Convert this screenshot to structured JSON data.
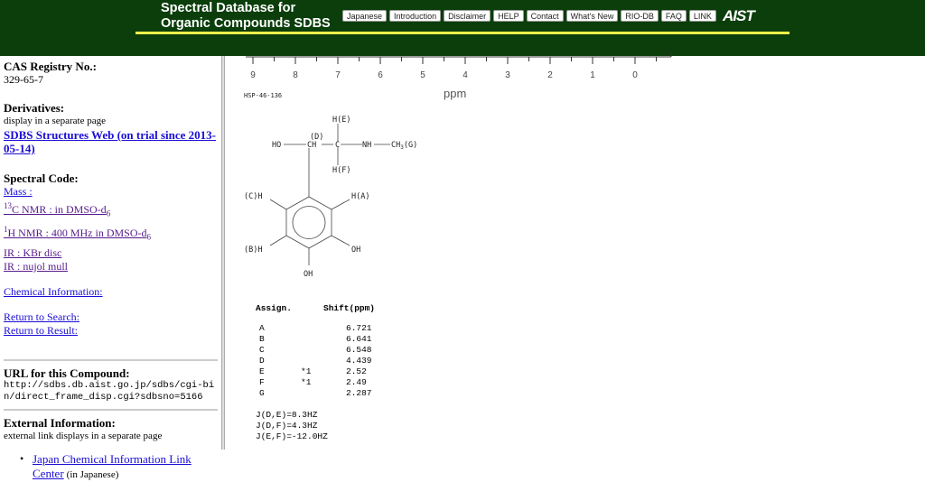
{
  "header": {
    "title_line1": "Spectral Database for",
    "title_line2": "Organic Compounds SDBS",
    "nav": [
      "Japanese",
      "Introduction",
      "Disclaimer",
      "HELP",
      "Contact",
      "What's New",
      "RIO-DB",
      "FAQ",
      "LINK"
    ],
    "logo": "AIST"
  },
  "left": {
    "cas_label": "CAS Registry No.:",
    "cas_value": "329-65-7",
    "deriv_label": "Derivatives:",
    "deriv_note": "display in a separate page",
    "deriv_link": "SDBS Structures Web (on trial since 2013-05-14)",
    "spec_label": "Spectral Code:",
    "mass": "Mass :",
    "c13_sup": "13",
    "c13": "C NMR : in DMSO-d",
    "c13_sub": "6",
    "h1_sup": "1",
    "h1": "H NMR : 400 MHz in DMSO-d",
    "h1_sub": "6",
    "ir1": "IR : KBr disc",
    "ir2": "IR : nujol mull",
    "chem": "Chemical Information:",
    "ret_search": "Return to Search:",
    "ret_result": "Return to Result:",
    "url_label": "URL for this Compound:",
    "url_value": "http://sdbs.db.aist.go.jp/sdbs/cgi-bin/direct_frame_disp.cgi?sdbsno=5166",
    "ext_label": "External Information:",
    "ext_note": "external link displays in a separate page",
    "ext_link": "Japan Chemical Information Link Center",
    "ext_link_note": "(in Japanese)"
  },
  "spectrum": {
    "ticks": [
      "9",
      "8",
      "7",
      "6",
      "5",
      "4",
      "3",
      "2",
      "1",
      "0"
    ],
    "axis_label": "ppm",
    "code": "HSP-46-136"
  },
  "structure": {
    "HE": "H(E)",
    "D": "(D)",
    "HO": "HO",
    "CH": "CH",
    "C": "C",
    "NH": "NH",
    "CH3": "CH",
    "sub3": "3",
    "G": "(G)",
    "HF": "H(F)",
    "CH_C": "(C)H",
    "HA": "H(A)",
    "BH": "(B)H",
    "OH1": "OH",
    "OH2": "OH"
  },
  "table": {
    "h1": "Assign.",
    "h2": "Shift(ppm)",
    "rows": [
      [
        "A",
        "",
        "6.721"
      ],
      [
        "B",
        "",
        "6.641"
      ],
      [
        "C",
        "",
        "6.548"
      ],
      [
        "D",
        "",
        "4.439"
      ],
      [
        "E",
        "*1",
        "2.52"
      ],
      [
        "F",
        "*1",
        "2.49"
      ],
      [
        "G",
        "",
        "2.287"
      ]
    ],
    "j": [
      "J(D,E)=8.3HZ",
      "J(D,F)=4.3HZ",
      "J(E,F)=-12.0HZ"
    ]
  }
}
